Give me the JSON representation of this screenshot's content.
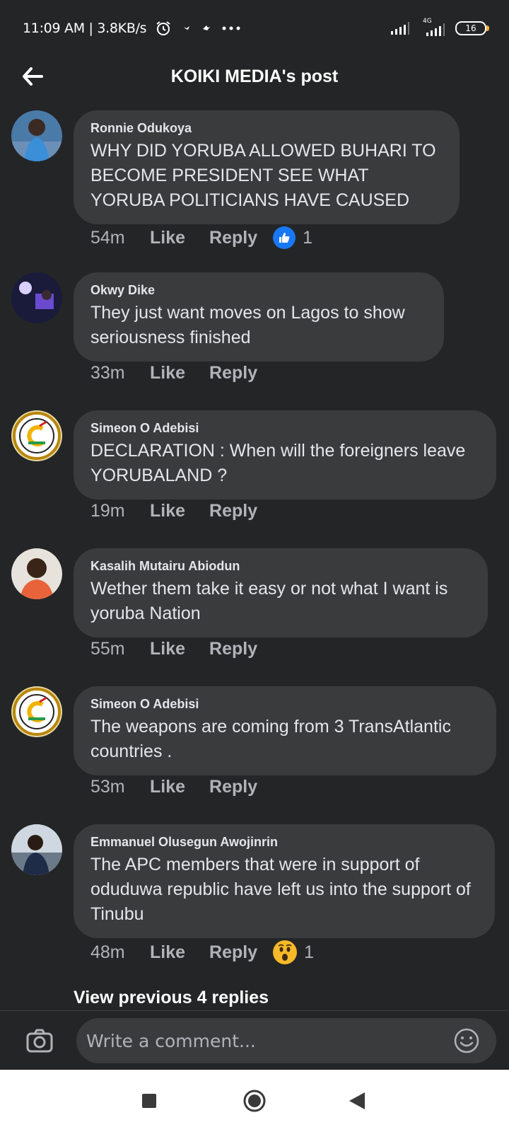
{
  "status_bar": {
    "time_speed": "11:09 AM | 3.8KB/s",
    "battery": "16",
    "network": "4G",
    "icons": [
      "alarm-icon",
      "notification-icon",
      "notification-icon",
      "more-dots-icon",
      "signal-icon",
      "battery-icon"
    ]
  },
  "header": {
    "title": "KOIKI MEDIA's post",
    "back_icon": "arrow-left-icon"
  },
  "comments": [
    {
      "author": "Ronnie Odukoya",
      "text": "WHY DID YORUBA ALLOWED BUHARI TO BECOME PRESIDENT SEE WHAT YORUBA POLITICIANS HAVE CAUSED",
      "time": "54m",
      "like_label": "Like",
      "reply_label": "Reply",
      "reaction": {
        "icon": "like-reaction-icon",
        "count": "1"
      }
    },
    {
      "author": "Okwy Dike",
      "text": "They just want moves on Lagos to show seriousness finished",
      "time": "33m",
      "like_label": "Like",
      "reply_label": "Reply"
    },
    {
      "author": "Simeon O Adebisi",
      "text": "DECLARATION : When will the foreigners leave YORUBALAND  ?",
      "time": "19m",
      "like_label": "Like",
      "reply_label": "Reply"
    },
    {
      "author": "Kasalih Mutairu Abiodun",
      "text": "Wether them take it easy or not what I want is yoruba Nation",
      "time": "55m",
      "like_label": "Like",
      "reply_label": "Reply"
    },
    {
      "author": "Simeon O Adebisi",
      "text": "The weapons are coming from 3 TransAtlantic countries .",
      "time": "53m",
      "like_label": "Like",
      "reply_label": "Reply"
    },
    {
      "author": "Emmanuel Olusegun Awojinrin",
      "text": "The APC members that were in support of oduduwa republic have left us into the support of Tinubu",
      "time": "48m",
      "like_label": "Like",
      "reply_label": "Reply",
      "reaction": {
        "icon": "wow-reaction-icon",
        "count": "1"
      }
    }
  ],
  "view_replies": "View previous 4 replies",
  "composer": {
    "placeholder": "Write a comment...",
    "camera_icon": "camera-icon",
    "emoji_icon": "emoji-icon"
  },
  "nav": [
    "recent-apps-icon",
    "home-icon",
    "back-icon"
  ],
  "colors": {
    "background": "#242526",
    "bubble": "#3a3b3c",
    "text": "#e4e6eb",
    "secondary_text": "#b0b3b8",
    "like_blue": "#1877f2",
    "wow_yellow": "#f7b928"
  }
}
